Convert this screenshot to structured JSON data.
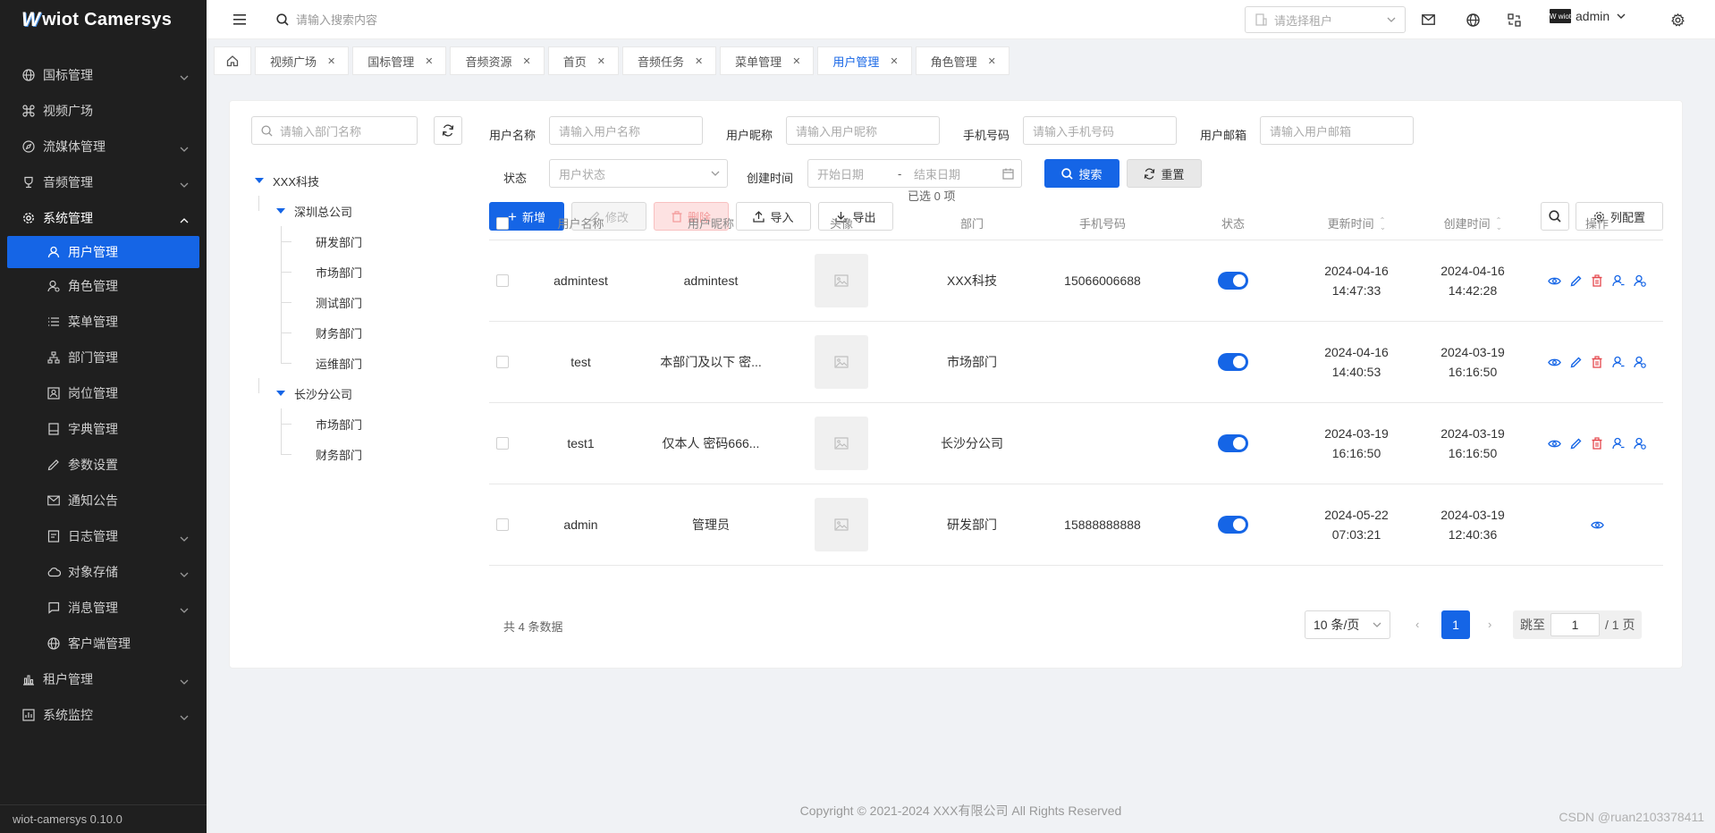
{
  "app": {
    "logo_prefix": "W",
    "logo_text": "wiot Camersys",
    "version": "wiot-camersys 0.10.0"
  },
  "sidebar": {
    "items": [
      {
        "label": "国标管理",
        "icon": "globe-icon",
        "expandable": true
      },
      {
        "label": "视频广场",
        "icon": "command-icon",
        "expandable": false
      },
      {
        "label": "流媒体管理",
        "icon": "compass-icon",
        "expandable": true
      },
      {
        "label": "音频管理",
        "icon": "trophy-icon",
        "expandable": true
      },
      {
        "label": "系统管理",
        "icon": "gear-icon",
        "expandable": true,
        "open": true
      }
    ],
    "sub_items": [
      {
        "label": "用户管理",
        "icon": "user-icon",
        "active": true
      },
      {
        "label": "角色管理",
        "icon": "role-icon"
      },
      {
        "label": "菜单管理",
        "icon": "list-icon"
      },
      {
        "label": "部门管理",
        "icon": "org-icon"
      },
      {
        "label": "岗位管理",
        "icon": "post-icon"
      },
      {
        "label": "字典管理",
        "icon": "book-icon"
      },
      {
        "label": "参数设置",
        "icon": "pencil-icon"
      },
      {
        "label": "通知公告",
        "icon": "mail-icon"
      },
      {
        "label": "日志管理",
        "icon": "log-icon",
        "expandable": true
      },
      {
        "label": "对象存储",
        "icon": "cloud-icon",
        "expandable": true
      },
      {
        "label": "消息管理",
        "icon": "message-icon",
        "expandable": true
      },
      {
        "label": "客户端管理",
        "icon": "globe-icon"
      }
    ],
    "bottom_items": [
      {
        "label": "租户管理",
        "icon": "chart-icon",
        "expandable": true
      },
      {
        "label": "系统监控",
        "icon": "monitor-icon",
        "expandable": true
      }
    ]
  },
  "header": {
    "search_placeholder": "请输入搜索内容",
    "tenant_placeholder": "请选择租户",
    "username": "admin",
    "avatar_text": "W wiot"
  },
  "tabs": [
    {
      "label": "视频广场",
      "active": false
    },
    {
      "label": "国标管理",
      "active": false
    },
    {
      "label": "音频资源",
      "active": false
    },
    {
      "label": "首页",
      "active": false
    },
    {
      "label": "音频任务",
      "active": false
    },
    {
      "label": "菜单管理",
      "active": false
    },
    {
      "label": "用户管理",
      "active": true
    },
    {
      "label": "角色管理",
      "active": false
    }
  ],
  "dept_tree": {
    "search_placeholder": "请输入部门名称",
    "root": "XXX科技",
    "branches": [
      {
        "label": "深圳总公司",
        "children": [
          "研发部门",
          "市场部门",
          "测试部门",
          "财务部门",
          "运维部门"
        ]
      },
      {
        "label": "长沙分公司",
        "children": [
          "市场部门",
          "财务部门"
        ]
      }
    ]
  },
  "filters": {
    "username_label": "用户名称",
    "username_placeholder": "请输入用户名称",
    "nickname_label": "用户昵称",
    "nickname_placeholder": "请输入用户昵称",
    "phone_label": "手机号码",
    "phone_placeholder": "请输入手机号码",
    "email_label": "用户邮箱",
    "email_placeholder": "请输入用户邮箱",
    "status_label": "状态",
    "status_placeholder": "用户状态",
    "created_label": "创建时间",
    "start_placeholder": "开始日期",
    "range_sep": "-",
    "end_placeholder": "结束日期",
    "search_btn": "搜索",
    "reset_btn": "重置"
  },
  "toolbar": {
    "add": "新增",
    "edit": "修改",
    "delete": "删除",
    "import": "导入",
    "export": "导出",
    "selected": "已选 0 项",
    "column_config": "列配置"
  },
  "table": {
    "columns": [
      "用户名称",
      "用户昵称",
      "头像",
      "部门",
      "手机号码",
      "状态",
      "更新时间",
      "创建时间",
      "操作"
    ],
    "rows": [
      {
        "username": "admintest",
        "nickname": "admintest",
        "dept": "XXX科技",
        "phone": "15066006688",
        "status_on": true,
        "updated_date": "2024-04-16",
        "updated_time": "14:47:33",
        "created_date": "2024-04-16",
        "created_time": "14:42:28",
        "ops": [
          "view",
          "edit",
          "delete",
          "assign-role",
          "reset"
        ]
      },
      {
        "username": "test",
        "nickname": "本部门及以下 密...",
        "dept": "市场部门",
        "phone": "",
        "status_on": true,
        "updated_date": "2024-04-16",
        "updated_time": "14:40:53",
        "created_date": "2024-03-19",
        "created_time": "16:16:50",
        "ops": [
          "view",
          "edit",
          "delete",
          "assign-role",
          "reset"
        ]
      },
      {
        "username": "test1",
        "nickname": "仅本人 密码666...",
        "dept": "长沙分公司",
        "phone": "",
        "status_on": true,
        "updated_date": "2024-03-19",
        "updated_time": "16:16:50",
        "created_date": "2024-03-19",
        "created_time": "16:16:50",
        "ops": [
          "view",
          "edit",
          "delete",
          "assign-role",
          "reset"
        ]
      },
      {
        "username": "admin",
        "nickname": "管理员",
        "dept": "研发部门",
        "phone": "15888888888",
        "status_on": true,
        "updated_date": "2024-05-22",
        "updated_time": "07:03:21",
        "created_date": "2024-03-19",
        "created_time": "12:40:36",
        "ops": [
          "view"
        ]
      }
    ]
  },
  "pagination": {
    "total": "共 4 条数据",
    "page_size": "10 条/页",
    "current": "1",
    "jump_label": "跳至",
    "jump_value": "1",
    "page_total": "/ 1 页"
  },
  "footer": {
    "copyright": "Copyright © 2021-2024 XXX有限公司 All Rights Reserved",
    "watermark": "CSDN @ruan2103378411"
  },
  "colors": {
    "primary": "#1565e6",
    "sidebar_bg": "#1f1f1f",
    "danger": "#e5484d"
  }
}
